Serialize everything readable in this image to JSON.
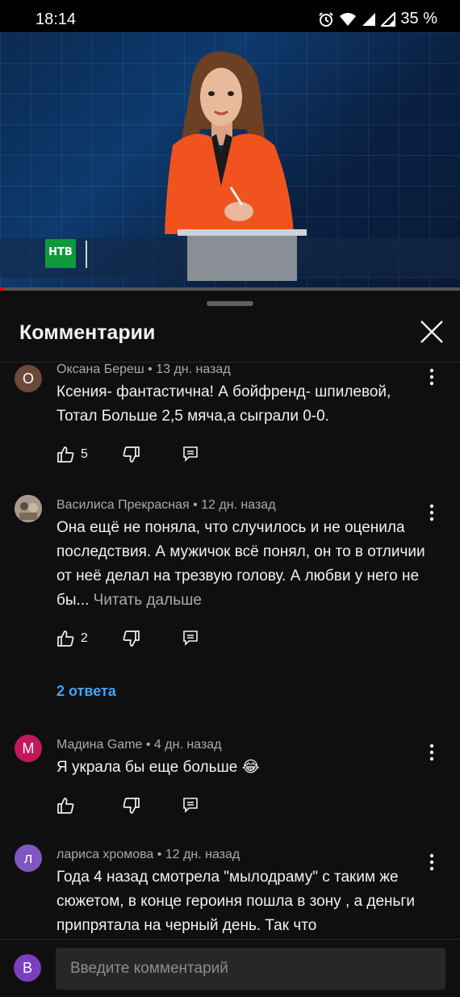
{
  "status_bar": {
    "time": "18:14",
    "battery": "35 %",
    "icons": [
      "alarm-icon",
      "wifi-icon",
      "signal-icon",
      "signal-icon"
    ]
  },
  "video": {
    "channel_logo_text": "НТВ",
    "progress_fraction": 0.01,
    "progress_color": "#ff0000"
  },
  "comments_panel": {
    "title": "Комментарии",
    "comments": [
      {
        "avatar_letter": "О",
        "avatar_color": "#6b4a3a",
        "author": "Оксана Береш",
        "age": "13 дн. назад",
        "meta": "Оксана Береш • 13 дн. назад",
        "text": "Ксения- фантастична! А бойфренд- шпилевой, Тотал Больше 2,5 мяча,а сыграли 0-0.",
        "likes": "5"
      },
      {
        "avatar_letter": "",
        "avatar_color": "#8a8276",
        "author": "Василиса Прекрасная",
        "age": "12 дн. назад",
        "meta": "Василиса Прекрасная • 12 дн. назад",
        "text": "Она ещё не поняла, что случилось и не оценила последствия. А мужичок всё понял, он то в отличии от неё делал на трезвую голову. А любви у него не бы...",
        "read_more": "Читать дальше",
        "likes": "2",
        "replies": "2 ответа"
      },
      {
        "avatar_letter": "М",
        "avatar_color": "#c2185b",
        "author": "Мадина Game",
        "age": "4 дн. назад",
        "meta": "Мадина Game • 4 дн. назад",
        "text": "Я украла бы еще больше 😂",
        "likes": ""
      },
      {
        "avatar_letter": "л",
        "avatar_color": "#7e57c2",
        "author": "лариса хромова",
        "age": "12 дн. назад",
        "meta": "лариса хромова • 12 дн. назад",
        "text": "Года 4 назад смотрела \"мылодраму\" с таким же сюжетом, в конце героиня пошла в зону , а деньги припрятала на черный день. Так что"
      }
    ],
    "input": {
      "avatar_letter": "В",
      "avatar_color": "#7b3fbf",
      "placeholder": "Введите комментарий"
    }
  }
}
